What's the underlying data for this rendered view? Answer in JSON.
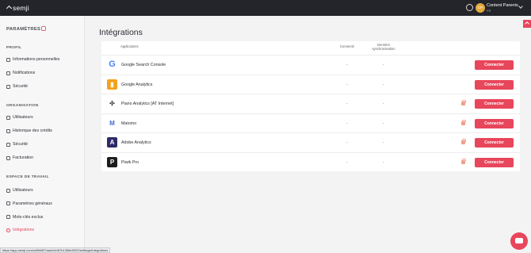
{
  "topbar": {
    "brand": "semji",
    "user_name": "Content Parents",
    "user_sub": "FR",
    "avatar_initials": "CP"
  },
  "sidebar": {
    "title": "PARAMÈTRES",
    "sections": [
      {
        "label": "PROFIL",
        "items": [
          {
            "label": "Informations personnelles",
            "icon": "user-icon"
          },
          {
            "label": "Notifications",
            "icon": "bell-icon"
          },
          {
            "label": "Sécurité",
            "icon": "lock-icon"
          }
        ]
      },
      {
        "label": "ORGANISATION",
        "items": [
          {
            "label": "Utilisateurs",
            "icon": "users-icon"
          },
          {
            "label": "Historique des crédits",
            "icon": "history-icon"
          },
          {
            "label": "Sécurité",
            "icon": "lock-icon"
          },
          {
            "label": "Facturation",
            "icon": "credit-card-icon"
          }
        ]
      },
      {
        "label": "ESPACE DE TRAVAIL",
        "items": [
          {
            "label": "Utilisateurs",
            "icon": "users-icon"
          },
          {
            "label": "Paramètres généraux",
            "icon": "gear-icon"
          },
          {
            "label": "Mots-clés exclus",
            "icon": "ban-icon"
          },
          {
            "label": "Intégrations",
            "icon": "integration-icon",
            "active": true
          }
        ]
      }
    ]
  },
  "main": {
    "title": "Intégrations",
    "columns": [
      "Applications",
      "Connecté",
      "Dernière synchronisation"
    ],
    "connect_label": "Connecter",
    "rows": [
      {
        "name": "Google Search Console",
        "connected": "-",
        "last_sync": "-",
        "locked": false,
        "icon": "google-icon",
        "color": "#4285f4"
      },
      {
        "name": "Google Analytics",
        "connected": "-",
        "last_sync": "-",
        "locked": false,
        "icon": "google-analytics-icon",
        "color": "#f4a21b"
      },
      {
        "name": "Piano Analytics [AT Internet]",
        "connected": "-",
        "last_sync": "-",
        "locked": true,
        "icon": "piano-analytics-icon",
        "color": "#3b3e45"
      },
      {
        "name": "Matomo",
        "connected": "-",
        "last_sync": "-",
        "locked": true,
        "icon": "matomo-icon",
        "color": "#3f6fd1"
      },
      {
        "name": "Adobe Analytics",
        "connected": "-",
        "last_sync": "-",
        "locked": true,
        "icon": "adobe-analytics-icon",
        "color": "#2e2a6b"
      },
      {
        "name": "Piwik Pro",
        "connected": "-",
        "last_sync": "-",
        "locked": true,
        "icon": "piwik-pro-icon",
        "color": "#1c1c1c"
      }
    ]
  },
  "status_url": "https://app.semji.com/o/8fb0f07aa4c0e/67b1306e9022/settings/integrations"
}
